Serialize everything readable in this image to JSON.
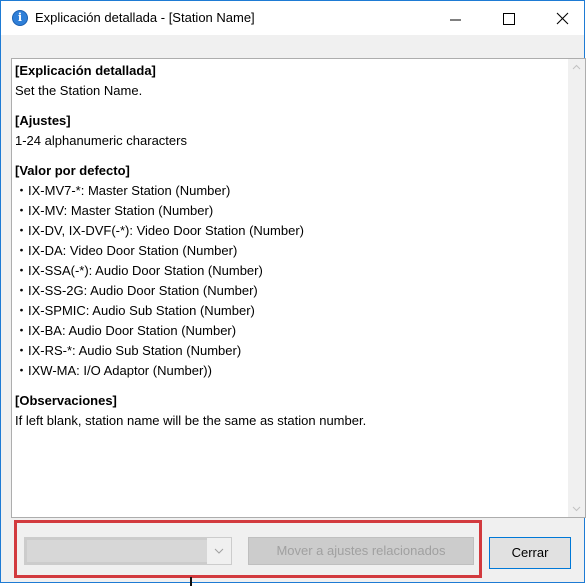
{
  "window": {
    "title": "Explicación detallada - [Station Name]",
    "title_icon_glyph": "i",
    "icons": [
      "info-icon",
      "minimize-icon",
      "maximize-icon",
      "close-icon"
    ]
  },
  "content": {
    "lines": [
      {
        "text": "[Explicación detallada]",
        "bold": true
      },
      {
        "text": "Set the Station Name.",
        "bold": false
      },
      {
        "text": "",
        "bold": false
      },
      {
        "text": "[Ajustes]",
        "bold": true
      },
      {
        "text": "1-24 alphanumeric characters",
        "bold": false
      },
      {
        "text": "",
        "bold": false
      },
      {
        "text": "[Valor por defecto]",
        "bold": true
      },
      {
        "text": "・IX-MV7-*: Master Station (Number)",
        "bold": false
      },
      {
        "text": "・IX-MV: Master Station (Number)",
        "bold": false
      },
      {
        "text": "・IX-DV, IX-DVF(-*): Video Door Station (Number)",
        "bold": false
      },
      {
        "text": "・IX-DA: Video Door Station (Number)",
        "bold": false
      },
      {
        "text": "・IX-SSA(-*): Audio Door Station (Number)",
        "bold": false
      },
      {
        "text": "・IX-SS-2G: Audio Door Station (Number)",
        "bold": false
      },
      {
        "text": "・IX-SPMIC: Audio Sub Station (Number)",
        "bold": false
      },
      {
        "text": "・IX-BA: Audio Door Station (Number)",
        "bold": false
      },
      {
        "text": "・IX-RS-*: Audio Sub Station (Number)",
        "bold": false
      },
      {
        "text": "・IXW-MA: I/O Adaptor (Number))",
        "bold": false
      },
      {
        "text": "",
        "bold": false
      },
      {
        "text": "[Observaciones]",
        "bold": true
      },
      {
        "text": "If left blank, station name will be the same as station number.",
        "bold": false
      }
    ]
  },
  "footer": {
    "related_settings_dropdown_value": "",
    "related_settings_button": "Mover a ajustes relacionados",
    "close_button": "Cerrar",
    "highlight_color": "#d23a3e"
  },
  "colors": {
    "window_border": "#1e7bd4",
    "info_icon": "#2f7fd8",
    "focus_border": "#0078d7"
  }
}
